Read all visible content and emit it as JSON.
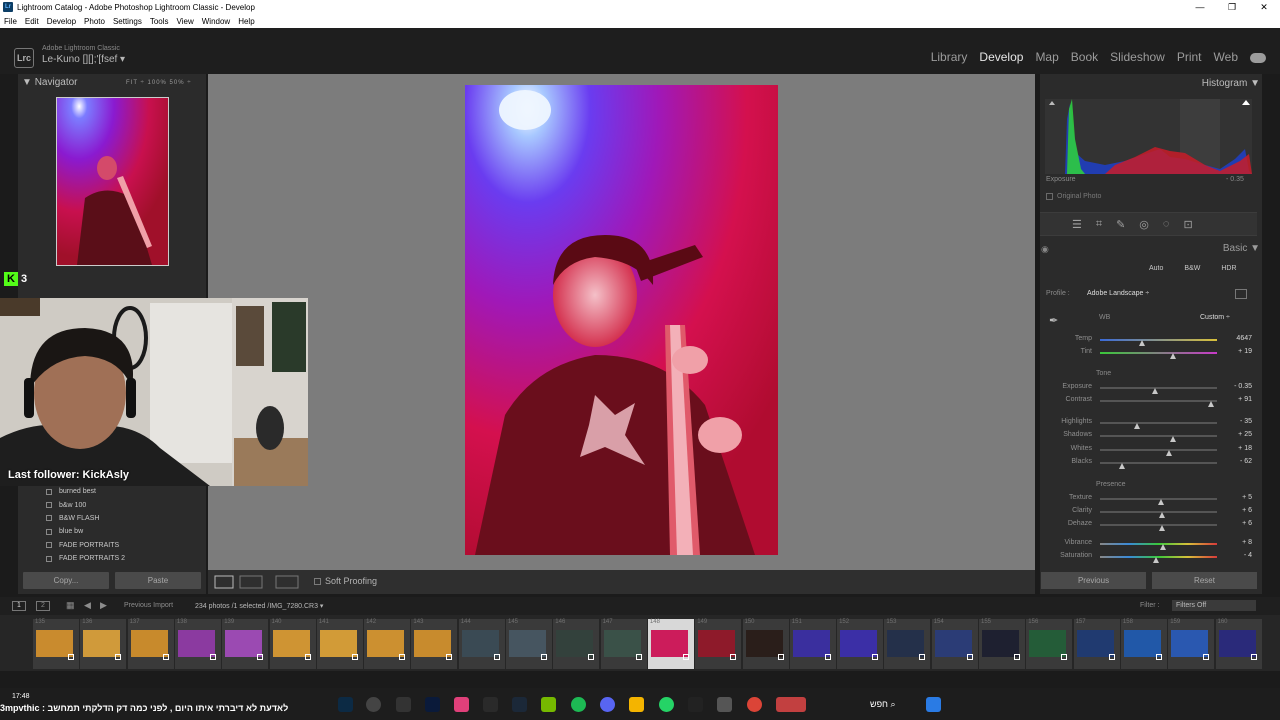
{
  "window": {
    "title": "Lightroom Catalog - Adobe Photoshop Lightroom Classic - Develop",
    "icon": "Lr",
    "minimize": "—",
    "maximize": "❐",
    "close": "✕"
  },
  "menu": [
    "File",
    "Edit",
    "Develop",
    "Photo",
    "Settings",
    "Tools",
    "View",
    "Window",
    "Help"
  ],
  "identity": {
    "logo": "Lrc",
    "app_name": "Adobe Lightroom Classic",
    "user": "Le-Kuno [][];'[fsef ▾"
  },
  "modules": [
    "Library",
    "Develop",
    "Map",
    "Book",
    "Slideshow",
    "Print",
    "Web"
  ],
  "active_module": "Develop",
  "navigator": {
    "title": "Navigator",
    "zoom_options": "FIT ÷   100%   50%   ÷"
  },
  "presets": [
    "burned best",
    "b&w 100",
    "B&W FLASH",
    "blue bw",
    "FADE PORTRAITS",
    "FADE PORTRAITS 2"
  ],
  "left_buttons": {
    "copy": "Copy...",
    "paste": "Paste"
  },
  "toolbar": {
    "soft_proofing": "Soft Proofing"
  },
  "histogram": {
    "title": "Histogram",
    "exposure_label": "Exposure",
    "exposure_value": "- 0.35",
    "original_photo": "Original Photo"
  },
  "basic": {
    "title": "Basic",
    "auto": "Auto",
    "bw": "B&W",
    "hdr": "HDR",
    "profile_label": "Profile :",
    "profile_value": "Adobe Landscape ÷",
    "wb_label": "WB",
    "wb_value": "Custom ÷",
    "tone_label": "Tone",
    "presence_label": "Presence",
    "sliders": [
      {
        "label": "Temp",
        "value": "4647",
        "pos": 0.36
      },
      {
        "label": "Tint",
        "value": "+ 19",
        "pos": 0.62
      },
      {
        "label": "Exposure",
        "value": "- 0.35",
        "pos": 0.47
      },
      {
        "label": "Contrast",
        "value": "+ 91",
        "pos": 0.95
      },
      {
        "label": "Highlights",
        "value": "- 35",
        "pos": 0.32
      },
      {
        "label": "Shadows",
        "value": "+ 25",
        "pos": 0.62
      },
      {
        "label": "Whites",
        "value": "+ 18",
        "pos": 0.59
      },
      {
        "label": "Blacks",
        "value": "- 62",
        "pos": 0.19
      },
      {
        "label": "Texture",
        "value": "+ 5",
        "pos": 0.52
      },
      {
        "label": "Clarity",
        "value": "+ 6",
        "pos": 0.53
      },
      {
        "label": "Dehaze",
        "value": "+ 6",
        "pos": 0.53
      },
      {
        "label": "Vibrance",
        "value": "+ 8",
        "pos": 0.54
      },
      {
        "label": "Saturation",
        "value": "- 4",
        "pos": 0.48
      }
    ],
    "previous": "Previous",
    "reset": "Reset"
  },
  "filmstrip_bar": {
    "screen1": "1",
    "screen2": "2",
    "source": "Previous Import",
    "count": "234 photos /1 selected /IMG_7280.CR3 ▾",
    "filter_label": "Filter :",
    "filter_value": "Filters Off"
  },
  "filmstrip": {
    "numbers": [
      "135",
      "136",
      "137",
      "138",
      "139",
      "140",
      "141",
      "142",
      "143",
      "144",
      "145",
      "146",
      "147",
      "148",
      "149",
      "150",
      "151",
      "152",
      "153",
      "154",
      "155",
      "156",
      "157",
      "158",
      "159",
      "160"
    ],
    "colors": [
      "#c98b2e",
      "#d09a3a",
      "#c88a2c",
      "#8b3aa0",
      "#9b4ab2",
      "#cf9433",
      "#d29b37",
      "#cc9030",
      "#c88b2d",
      "#3a4a54",
      "#465560",
      "#33413c",
      "#3a5148",
      "#cc1c5b",
      "#8e1a2a",
      "#2a1e1a",
      "#3a2f9e",
      "#3b2fa6",
      "#24304a",
      "#2b3c76",
      "#1e2030",
      "#245c38",
      "#203a70",
      "#2158a8",
      "#2a58b0",
      "#2a2a7a"
    ],
    "selected_index": 13
  },
  "overlay": {
    "kick_count": "3",
    "last_follower": "Last follower: KickAsly"
  },
  "taskbar": {
    "time": "17:48",
    "ticker": "3mpvthic : לאדעת לא דיברתי איתו היום , לפני כמה דק הדלקתי תמחשב",
    "search": "חפש"
  },
  "colors": {
    "accent": "#e6e6e6",
    "panel": "#2b2b2b",
    "canvas": "#7c7c7c"
  }
}
